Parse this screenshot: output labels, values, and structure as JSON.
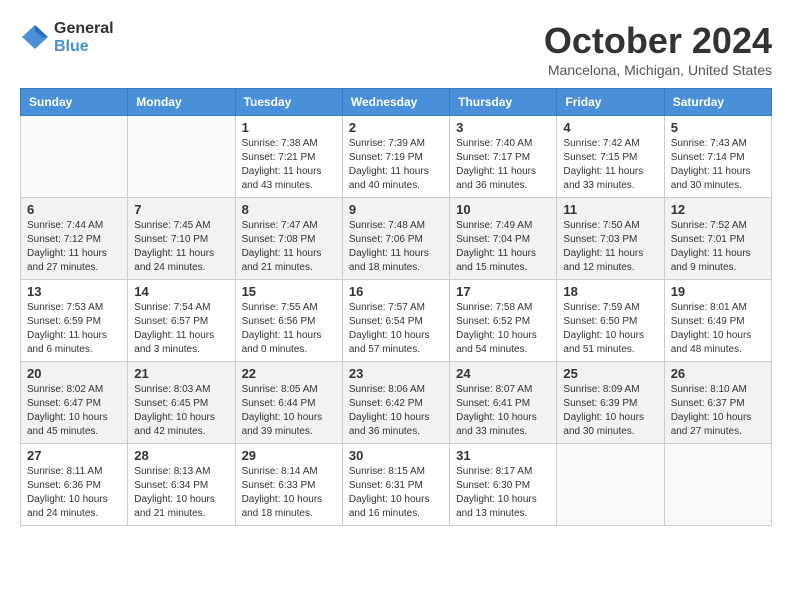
{
  "header": {
    "logo": {
      "general": "General",
      "blue": "Blue"
    },
    "title": "October 2024",
    "location": "Mancelona, Michigan, United States"
  },
  "days_of_week": [
    "Sunday",
    "Monday",
    "Tuesday",
    "Wednesday",
    "Thursday",
    "Friday",
    "Saturday"
  ],
  "rows": [
    {
      "cells": [
        {
          "empty": true
        },
        {
          "empty": true
        },
        {
          "day": "1",
          "sunrise": "7:38 AM",
          "sunset": "7:21 PM",
          "daylight": "11 hours and 43 minutes."
        },
        {
          "day": "2",
          "sunrise": "7:39 AM",
          "sunset": "7:19 PM",
          "daylight": "11 hours and 40 minutes."
        },
        {
          "day": "3",
          "sunrise": "7:40 AM",
          "sunset": "7:17 PM",
          "daylight": "11 hours and 36 minutes."
        },
        {
          "day": "4",
          "sunrise": "7:42 AM",
          "sunset": "7:15 PM",
          "daylight": "11 hours and 33 minutes."
        },
        {
          "day": "5",
          "sunrise": "7:43 AM",
          "sunset": "7:14 PM",
          "daylight": "11 hours and 30 minutes."
        }
      ]
    },
    {
      "cells": [
        {
          "day": "6",
          "sunrise": "7:44 AM",
          "sunset": "7:12 PM",
          "daylight": "11 hours and 27 minutes."
        },
        {
          "day": "7",
          "sunrise": "7:45 AM",
          "sunset": "7:10 PM",
          "daylight": "11 hours and 24 minutes."
        },
        {
          "day": "8",
          "sunrise": "7:47 AM",
          "sunset": "7:08 PM",
          "daylight": "11 hours and 21 minutes."
        },
        {
          "day": "9",
          "sunrise": "7:48 AM",
          "sunset": "7:06 PM",
          "daylight": "11 hours and 18 minutes."
        },
        {
          "day": "10",
          "sunrise": "7:49 AM",
          "sunset": "7:04 PM",
          "daylight": "11 hours and 15 minutes."
        },
        {
          "day": "11",
          "sunrise": "7:50 AM",
          "sunset": "7:03 PM",
          "daylight": "11 hours and 12 minutes."
        },
        {
          "day": "12",
          "sunrise": "7:52 AM",
          "sunset": "7:01 PM",
          "daylight": "11 hours and 9 minutes."
        }
      ]
    },
    {
      "cells": [
        {
          "day": "13",
          "sunrise": "7:53 AM",
          "sunset": "6:59 PM",
          "daylight": "11 hours and 6 minutes."
        },
        {
          "day": "14",
          "sunrise": "7:54 AM",
          "sunset": "6:57 PM",
          "daylight": "11 hours and 3 minutes."
        },
        {
          "day": "15",
          "sunrise": "7:55 AM",
          "sunset": "6:56 PM",
          "daylight": "11 hours and 0 minutes."
        },
        {
          "day": "16",
          "sunrise": "7:57 AM",
          "sunset": "6:54 PM",
          "daylight": "10 hours and 57 minutes."
        },
        {
          "day": "17",
          "sunrise": "7:58 AM",
          "sunset": "6:52 PM",
          "daylight": "10 hours and 54 minutes."
        },
        {
          "day": "18",
          "sunrise": "7:59 AM",
          "sunset": "6:50 PM",
          "daylight": "10 hours and 51 minutes."
        },
        {
          "day": "19",
          "sunrise": "8:01 AM",
          "sunset": "6:49 PM",
          "daylight": "10 hours and 48 minutes."
        }
      ]
    },
    {
      "cells": [
        {
          "day": "20",
          "sunrise": "8:02 AM",
          "sunset": "6:47 PM",
          "daylight": "10 hours and 45 minutes."
        },
        {
          "day": "21",
          "sunrise": "8:03 AM",
          "sunset": "6:45 PM",
          "daylight": "10 hours and 42 minutes."
        },
        {
          "day": "22",
          "sunrise": "8:05 AM",
          "sunset": "6:44 PM",
          "daylight": "10 hours and 39 minutes."
        },
        {
          "day": "23",
          "sunrise": "8:06 AM",
          "sunset": "6:42 PM",
          "daylight": "10 hours and 36 minutes."
        },
        {
          "day": "24",
          "sunrise": "8:07 AM",
          "sunset": "6:41 PM",
          "daylight": "10 hours and 33 minutes."
        },
        {
          "day": "25",
          "sunrise": "8:09 AM",
          "sunset": "6:39 PM",
          "daylight": "10 hours and 30 minutes."
        },
        {
          "day": "26",
          "sunrise": "8:10 AM",
          "sunset": "6:37 PM",
          "daylight": "10 hours and 27 minutes."
        }
      ]
    },
    {
      "cells": [
        {
          "day": "27",
          "sunrise": "8:11 AM",
          "sunset": "6:36 PM",
          "daylight": "10 hours and 24 minutes."
        },
        {
          "day": "28",
          "sunrise": "8:13 AM",
          "sunset": "6:34 PM",
          "daylight": "10 hours and 21 minutes."
        },
        {
          "day": "29",
          "sunrise": "8:14 AM",
          "sunset": "6:33 PM",
          "daylight": "10 hours and 18 minutes."
        },
        {
          "day": "30",
          "sunrise": "8:15 AM",
          "sunset": "6:31 PM",
          "daylight": "10 hours and 16 minutes."
        },
        {
          "day": "31",
          "sunrise": "8:17 AM",
          "sunset": "6:30 PM",
          "daylight": "10 hours and 13 minutes."
        },
        {
          "empty": true
        },
        {
          "empty": true
        }
      ]
    }
  ],
  "row_shading": [
    "light",
    "dark",
    "light",
    "dark",
    "light"
  ]
}
